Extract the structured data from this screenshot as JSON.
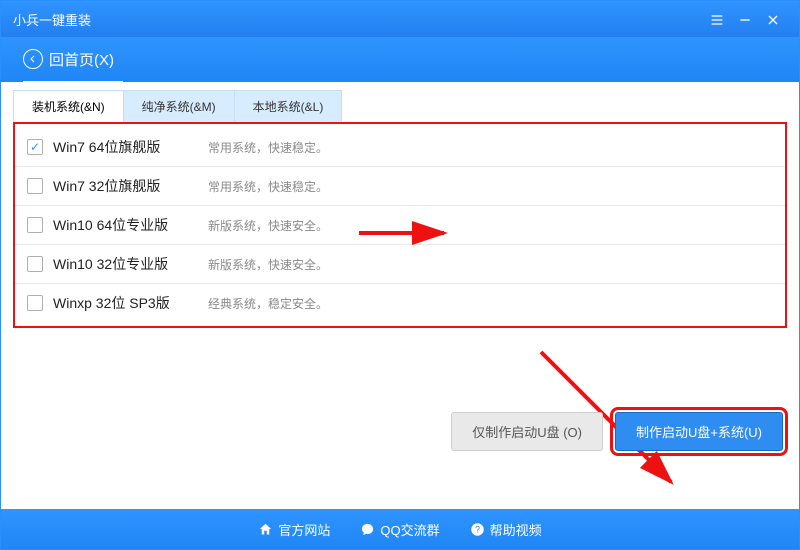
{
  "window": {
    "title": "小兵一键重装"
  },
  "nav": {
    "back_label": "回首页(X)"
  },
  "tabs": [
    {
      "label": "装机系统(&N)",
      "active": true
    },
    {
      "label": "纯净系统(&M)",
      "active": false
    },
    {
      "label": "本地系统(&L)",
      "active": false
    }
  ],
  "systems": [
    {
      "checked": true,
      "name": "Win7 64位旗舰版",
      "desc": "常用系统，快速稳定。"
    },
    {
      "checked": false,
      "name": "Win7 32位旗舰版",
      "desc": "常用系统，快速稳定。"
    },
    {
      "checked": false,
      "name": "Win10 64位专业版",
      "desc": "新版系统，快速安全。"
    },
    {
      "checked": false,
      "name": "Win10 32位专业版",
      "desc": "新版系统，快速安全。"
    },
    {
      "checked": false,
      "name": "Winxp 32位 SP3版",
      "desc": "经典系统，稳定安全。"
    }
  ],
  "buttons": {
    "make_boot_only": "仅制作启动U盘 (O)",
    "make_boot_system": "制作启动U盘+系统(U)"
  },
  "footer": {
    "site": "官方网站",
    "qq": "QQ交流群",
    "help": "帮助视频"
  }
}
